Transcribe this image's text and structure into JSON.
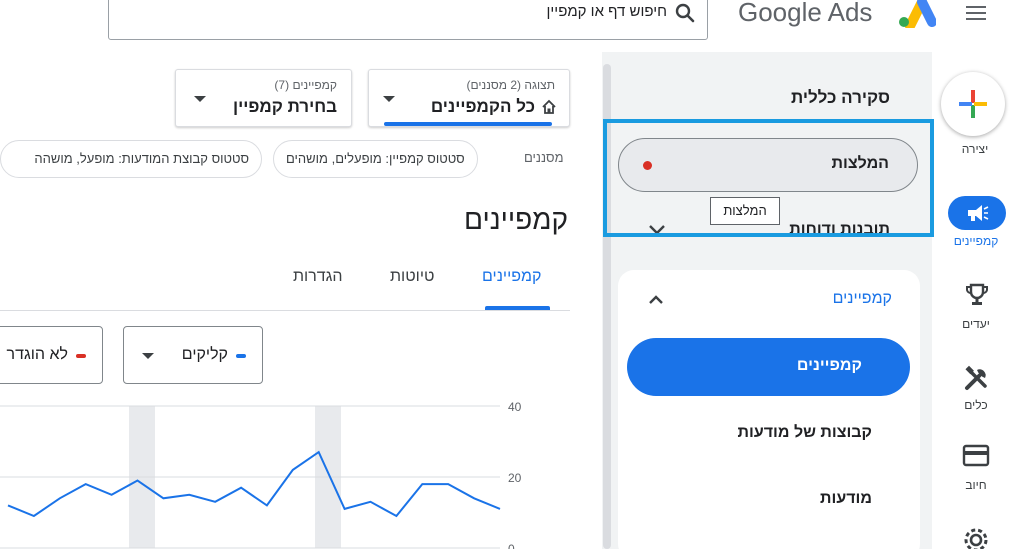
{
  "brand": {
    "name": "Google Ads"
  },
  "search": {
    "placeholder": "חיפוש דף או קמפיין"
  },
  "rail": {
    "create_label": "יצירה",
    "campaigns_label": "קמפיינים",
    "goals_label": "יעדים",
    "tools_label": "כלים",
    "billing_label": "חיוב"
  },
  "nav": {
    "overview": "סקירה כללית",
    "recommendations": "המלצות",
    "tooltip": "המלצות",
    "insights": "תובנות ודוחות",
    "campaigns_group": "קמפיינים",
    "selected_item": "קמפיינים",
    "ad_groups": "קבוצות של מודעות",
    "ads": "מודעות"
  },
  "filters": {
    "view_small": "תצוגה (2 מסננים)",
    "view_big": "כל הקמפיינים",
    "campaign_small": "קמפיינים (7)",
    "campaign_big": "בחירת קמפיין",
    "label": "מסננים",
    "chip_campaign_status": "סטטוס קמפיין: מופעלים, מושהים",
    "chip_adgroup_status": "סטטוס קבוצת המודעות: מופעל, מושהה"
  },
  "main": {
    "title": "קמפיינים",
    "tabs": [
      "קמפיינים",
      "טיוטות",
      "הגדרות"
    ],
    "metric_1": "קליקים",
    "metric_2": "לא הוגדר"
  },
  "colors": {
    "accent": "#1a73e8",
    "highlight": "#1a9be0",
    "red": "#d93025"
  },
  "chart_data": {
    "type": "line",
    "y_ticks": [
      "40",
      "20",
      "0"
    ],
    "ylim": [
      0,
      40
    ],
    "series": [
      {
        "values": [
          12,
          9,
          14,
          18,
          15,
          19,
          14,
          15,
          13,
          17,
          12,
          22,
          27,
          11,
          13,
          9,
          18,
          18,
          14,
          11
        ]
      }
    ]
  }
}
